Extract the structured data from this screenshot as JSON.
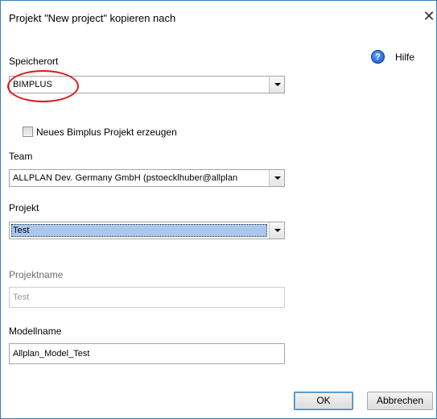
{
  "window": {
    "title": "Projekt \"New project\" kopieren nach",
    "close_glyph": "✕"
  },
  "help": {
    "icon": "help-icon",
    "icon_glyph": "?",
    "label": "Hilfe"
  },
  "speicherort": {
    "label": "Speicherort",
    "value": "BIMPLUS"
  },
  "checkbox": {
    "label": "Neues Bimplus Projekt erzeugen",
    "checked": false
  },
  "team": {
    "label": "Team",
    "value": "ALLPLAN Dev. Germany GmbH (pstoecklhuber@allplan"
  },
  "projekt": {
    "label": "Projekt",
    "value": "Test"
  },
  "projektname": {
    "label": "Projektname",
    "value": "Test"
  },
  "modellname": {
    "label": "Modellname",
    "value": "Allplan_Model_Test"
  },
  "buttons": {
    "ok": "OK",
    "cancel": "Abbrechen"
  },
  "colors": {
    "annotation": "#d31d1d",
    "selection": "#aac7ee",
    "border_accent": "#3c7fb1"
  }
}
